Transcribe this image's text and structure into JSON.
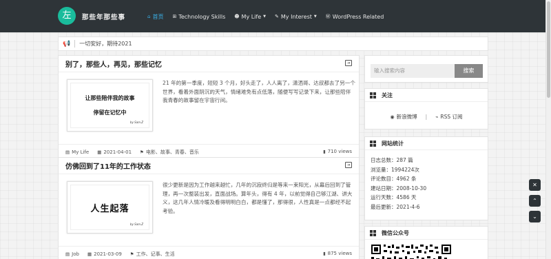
{
  "header": {
    "logo_char": "左",
    "site_name": "那些年那些事",
    "nav": [
      {
        "label": "首页",
        "icon": "home-icon",
        "active": true
      },
      {
        "label": "Technology Skills",
        "icon": "windows-icon"
      },
      {
        "label": "My Life",
        "icon": "users-icon",
        "has_dropdown": true
      },
      {
        "label": "My Interest",
        "icon": "wrench-icon",
        "has_dropdown": true
      },
      {
        "label": "WordPress Related",
        "icon": "wordpress-icon"
      }
    ]
  },
  "notice": {
    "text": "一切安好，期待2021"
  },
  "posts": [
    {
      "title": "别了，那些人，再见，那些记忆",
      "thumb_line1": "让那些陪伴我的故事",
      "thumb_line2": "停留在记忆中",
      "thumb_sign": "by Sam.Z",
      "excerpt": "21 年的第一季度，短短 3 个月，好头走了，人人离了，潇洒哥、达叔都去了另一个世界，看着外面阴沉的天气，情绪难免有点低落，随便写写记录下来，让那些陪伴我青春的故事留在宇宙行间。",
      "category": "My Life",
      "date": "2021-04-01",
      "tags": "电影、故事、青春、音乐",
      "views": "710 views"
    },
    {
      "title": "仿佛回到了11年的工作状态",
      "thumb_big": "人生起落",
      "thumb_sign": "by Sam.Z",
      "excerpt": "很少更新是因为工作越来越忙，几年的沉寂终归是等来一束阳光，从幕后回到了管理，再一次整装出发，直面战场。算年头，得有 4 年，以前觉得自己够江湖、讲大义，这几年人情冷暖及看得明明白白，都是懂了，那得很，人性真是一点都经不起考验。",
      "category": "Job",
      "date": "2021-03-09",
      "tags": "工作、记事、生活",
      "views": "875 views"
    }
  ],
  "sidebar": {
    "search": {
      "placeholder": "输入搜索内容",
      "button": "搜索"
    },
    "follow": {
      "title": "关注",
      "weibo": "新浪微博",
      "divider": "|",
      "rss": "RSS 订阅"
    },
    "stats": {
      "title": "网站统计",
      "rows": [
        "日志总数：287 篇",
        "浏览量：1994224次",
        "评论数目：4962 条",
        "建站日期：2008-10-30",
        "运行天数：4586 天",
        "最后更新：2021-4-6"
      ]
    },
    "wechat": {
      "title": "微信公众号"
    }
  },
  "float_buttons": {
    "close": "✕",
    "up": "⌃",
    "down": "⌄"
  }
}
